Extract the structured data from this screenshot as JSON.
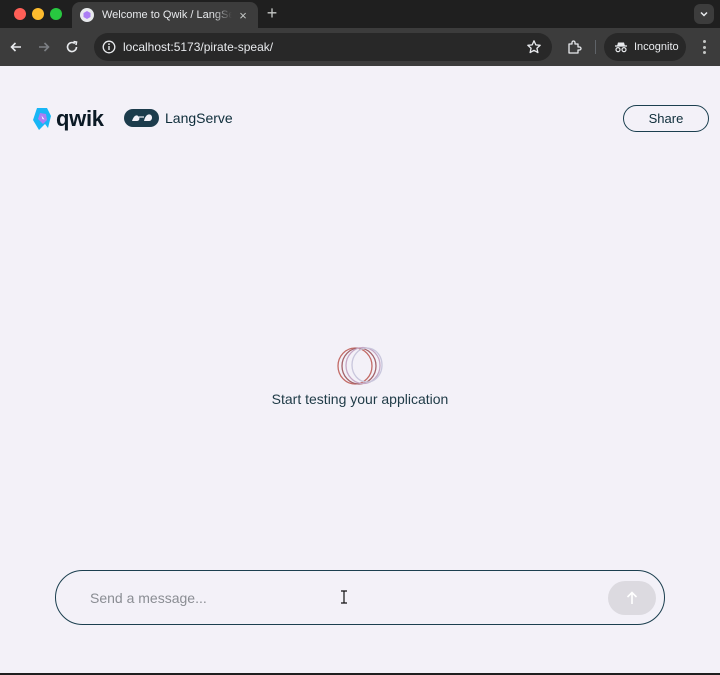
{
  "browser": {
    "tab_title": "Welcome to Qwik / LangServe",
    "tab_close": "×",
    "new_tab": "+",
    "url": "localhost:5173/pirate-speak/",
    "incognito_label": "Incognito"
  },
  "header": {
    "qwik_logo_text": "qwik",
    "langserve_logo_text": "LangServe",
    "share_label": "Share"
  },
  "main": {
    "empty_state_text": "Start testing your application"
  },
  "chat": {
    "placeholder": "Send a message...",
    "value": ""
  },
  "colors": {
    "page_background": "#f3f1f8",
    "accent_dark": "#1b3f4f",
    "qwik_blue": "#18b6f6",
    "qwik_purple": "#ac7ef4"
  }
}
